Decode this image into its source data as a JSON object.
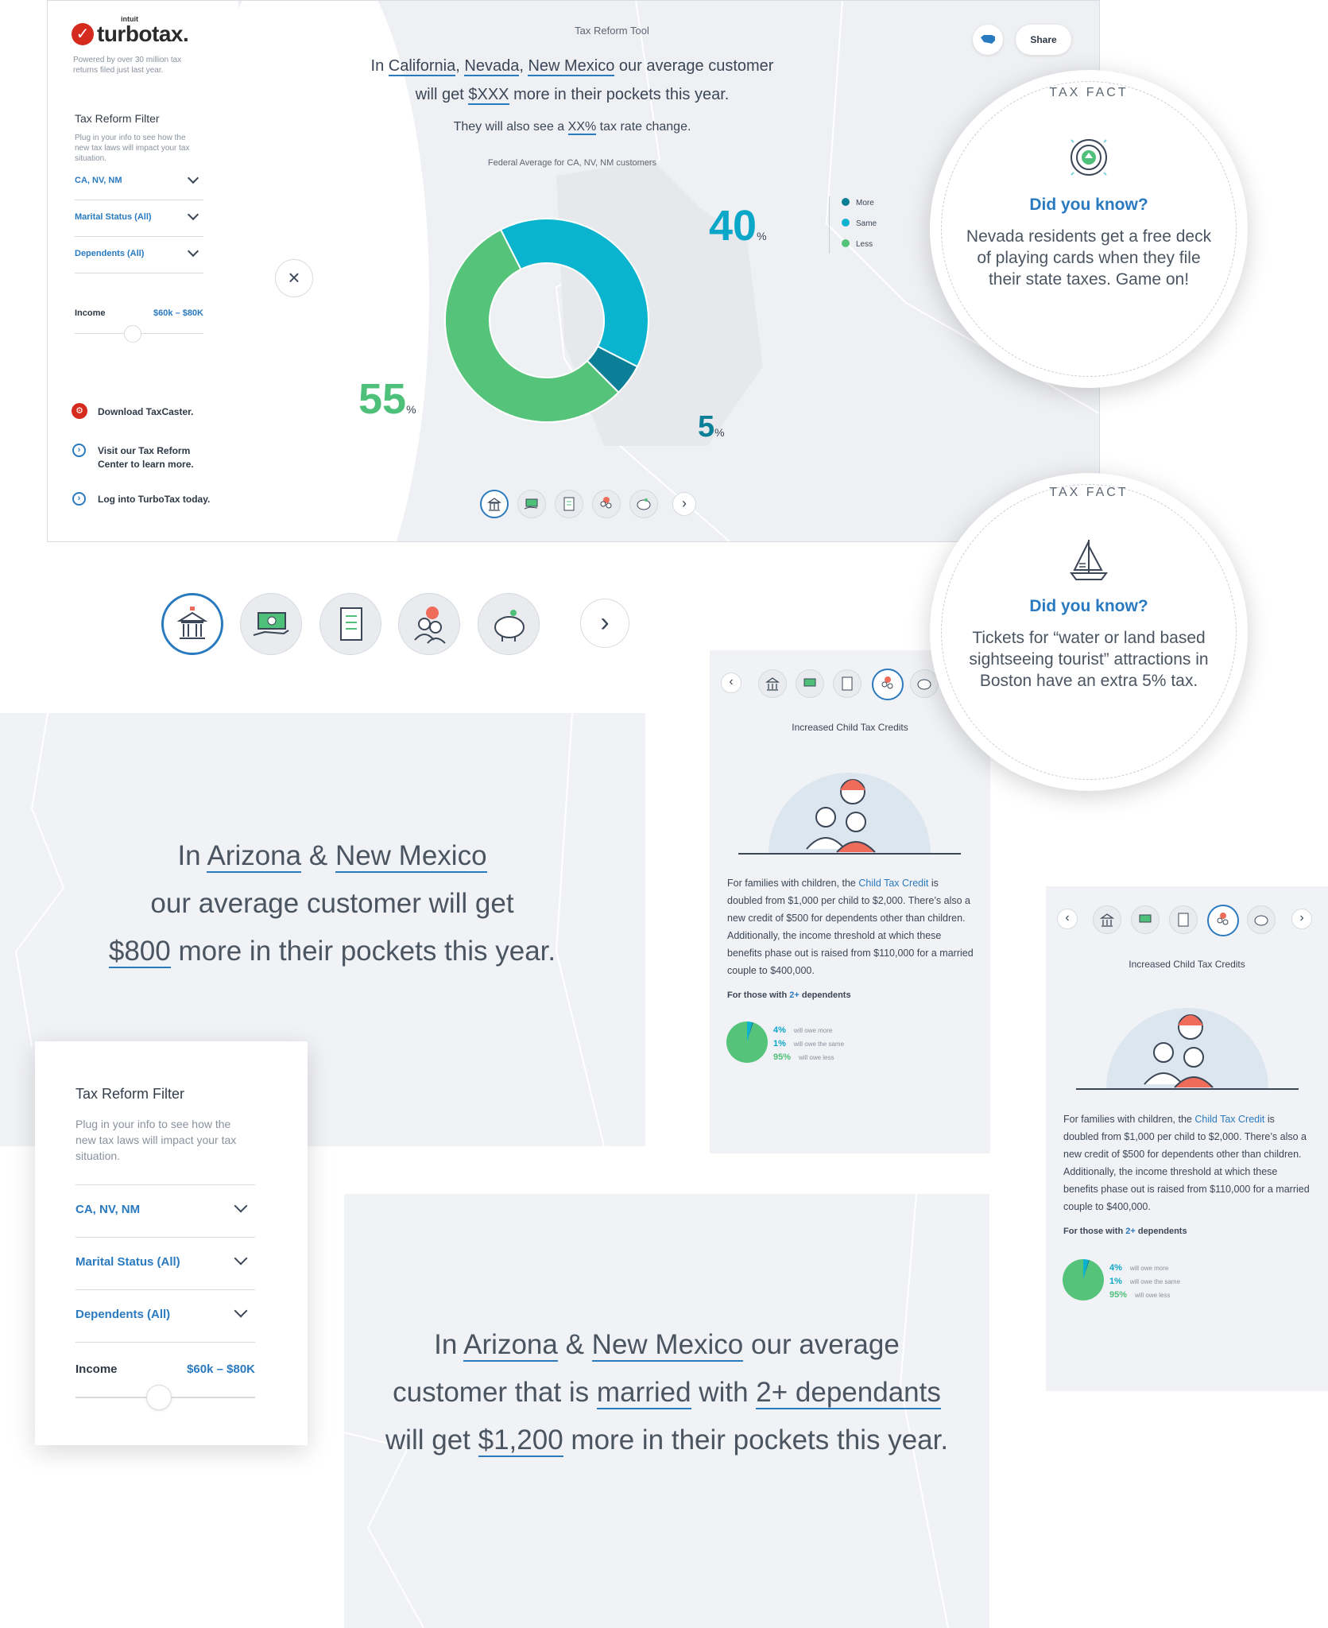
{
  "tool": {
    "logo_intuit": "intuit",
    "logo_word": "turbotax.",
    "tagline": "Powered by over 30 million tax returns filed just last year.",
    "filter_title": "Tax Reform Filter",
    "filter_desc": "Plug in your info to see how the new tax laws will impact your tax situation.",
    "filters": [
      "CA, NV, NM",
      "Marital Status (All)",
      "Dependents (All)"
    ],
    "income_label": "Income",
    "income_value": "$60k – $80K",
    "links": [
      "Download TaxCaster.",
      "Visit our Tax Reform Center to learn more.",
      "Log into TurboTax today."
    ],
    "page_label": "Tax Reform Tool",
    "share_label": "Share",
    "headline_prefix": "In",
    "states": [
      "California",
      "Nevada",
      "New Mexico"
    ],
    "headline_mid": "our average customer",
    "headline_line2_a": "will get",
    "headline_amount": "$XXX",
    "headline_line2_b": "more in their pockets this year.",
    "sub_a": "They will also see a",
    "sub_amount": "XX%",
    "sub_b": "tax rate change.",
    "chart_caption": "Federal Average for CA, NV, NM customers",
    "close_icon": "×",
    "next_icon": "›"
  },
  "chart_data": {
    "type": "pie",
    "title": "Federal Average for CA, NV, NM customers",
    "categories": [
      "More",
      "Same",
      "Less"
    ],
    "values": [
      40,
      5,
      55
    ],
    "labels": [
      "40",
      "5",
      "55"
    ],
    "unit": "%",
    "colors": {
      "More": "#0ab4cf",
      "Same": "#0b7f97",
      "Less": "#55c47a"
    },
    "legend": [
      "More",
      "Same",
      "Less"
    ],
    "legend_colors": [
      "#0b7f97",
      "#0ab4cf",
      "#55c47a"
    ],
    "legend_placement": "right"
  },
  "fact1": {
    "label": "TAX FACT",
    "title": "Did you know?",
    "body": "Nevada residents get a free deck of playing cards when they file their state taxes. Game on!"
  },
  "fact2": {
    "label": "TAX FACT",
    "title": "Did you know?",
    "body": "Tickets for “water or land based sightseeing tourist” attractions in Boston have an extra 5% tax."
  },
  "panel1": {
    "l1a": "In",
    "l1s1": "Arizona",
    "l1b": "&",
    "l1s2": "New Mexico",
    "l2": "our average customer will get",
    "l3amount": "$800",
    "l3b": "more in their pockets this year."
  },
  "panel2": {
    "l1a": "In",
    "l1s1": "Arizona",
    "l1b": "&",
    "l1s2": "New Mexico",
    "l1c": "our average",
    "l2a": "customer that is",
    "l2s1": "married",
    "l2b": "with",
    "l2s2": "2+ dependants",
    "l3a": "will get",
    "l3amount": "$1,200",
    "l3b": "more in their pockets this year."
  },
  "mobile": {
    "title": "Increased Child Tax Credits",
    "text_a": "For families with children, the",
    "text_link": "Child Tax Credit",
    "text_b": "is doubled from $1,000 per child to $2,000. There’s also a new credit of $500 for dependents other than children. Additionally, the income threshold at which these benefits phase out is raised from $110,000 for a married couple to $400,000.",
    "those_a": "For those with",
    "those_b": "2+",
    "those_c": "dependents",
    "rows": [
      {
        "pct": "4",
        "label": "will owe more"
      },
      {
        "pct": "1",
        "label": "will owe the same"
      },
      {
        "pct": "95",
        "label": "will owe less"
      }
    ],
    "pct_sign": "%"
  },
  "filtercard": {
    "title": "Tax Reform Filter",
    "desc": "Plug in your info to see how the new tax laws will impact your tax situation.",
    "filters": [
      "CA, NV, NM",
      "Marital Status (All)",
      "Dependents (All)"
    ],
    "income_label": "Income",
    "income_value": "$60k – $80K"
  },
  "icons": [
    "bank-icon",
    "cash-hand-icon",
    "document-icon",
    "family-icon",
    "piggy-bank-icon"
  ]
}
